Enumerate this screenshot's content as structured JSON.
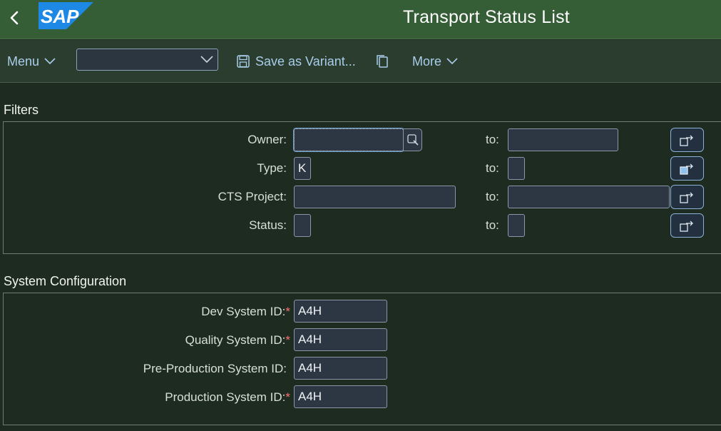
{
  "header": {
    "logo_text": "SAP",
    "title": "Transport Status List",
    "back_icon": "chevron-left-icon"
  },
  "toolbar": {
    "menu_label": "Menu",
    "variant_value": "",
    "save_variant_label": "Save as Variant...",
    "copy_icon": "copy-icon",
    "more_label": "More"
  },
  "filters": {
    "title": "Filters",
    "to_label": "to:",
    "rows": [
      {
        "label": "Owner:",
        "from": "",
        "to": ""
      },
      {
        "label": "Type:",
        "from": "K",
        "to": ""
      },
      {
        "label": "CTS Project:",
        "from": "",
        "to": ""
      },
      {
        "label": "Status:",
        "from": "",
        "to": ""
      }
    ]
  },
  "system_config": {
    "title": "System Configuration",
    "rows": [
      {
        "label": "Dev System ID:",
        "required": "*",
        "value": "A4H"
      },
      {
        "label": "Quality System ID:",
        "required": "*",
        "value": "A4H"
      },
      {
        "label": "Pre-Production System ID:",
        "required": "",
        "value": "A4H"
      },
      {
        "label": "Production System ID:",
        "required": "*",
        "value": "A4H"
      }
    ]
  },
  "colors": {
    "shell": "#355e36",
    "toolbar": "#2a3d2e",
    "background": "#1d2b20",
    "link": "#a9cdea",
    "required": "#ff6f6f"
  }
}
